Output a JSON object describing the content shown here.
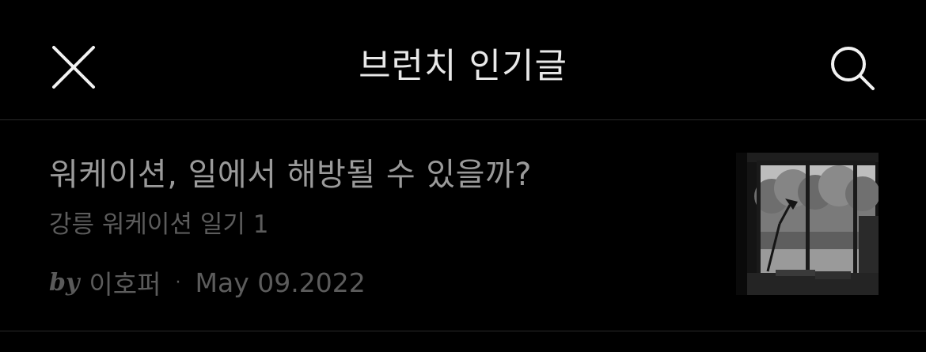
{
  "header": {
    "title": "브런치 인기글",
    "close_icon": "close-icon",
    "search_icon": "search-icon"
  },
  "article": {
    "title": "워케이션, 일에서 해방될 수 있을까?",
    "subtitle": "강릉 워케이션 일기 1",
    "by_label": "by",
    "author": "이호퍼",
    "separator": "·",
    "date": "May 09.2022",
    "thumbnail_icon": "window-desk-photo"
  },
  "colors": {
    "background": "#000000",
    "header_title": "#e8e8e8",
    "article_title": "#9a9a9a",
    "muted_text": "#5c5c5c",
    "divider": "#2a2a2a"
  }
}
